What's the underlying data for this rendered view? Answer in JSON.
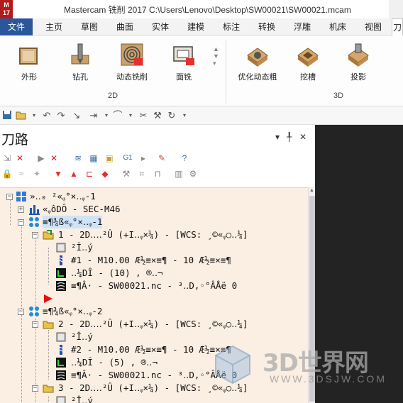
{
  "app": {
    "logo_text": "M\n17",
    "title": "Mastercam 铣削 2017  C:\\Users\\Lenovo\\Desktop\\SW00021\\SW00021.mcam"
  },
  "menu": {
    "tabs": [
      "文件",
      "主页",
      "草图",
      "曲面",
      "实体",
      "建模",
      "标注",
      "转换",
      "浮雕",
      "机床",
      "视图",
      "刀"
    ]
  },
  "ribbon": {
    "group_2d": {
      "label": "2D",
      "buttons": [
        "外形",
        "钻孔",
        "动态铣削",
        "面铣"
      ]
    },
    "group_3d": {
      "label": "3D",
      "buttons": [
        "优化动态粗",
        "挖槽",
        "投影"
      ]
    }
  },
  "panel": {
    "title": "刀路",
    "pin": "▾ ╀ ✕",
    "row1_glyph": "G1"
  },
  "tree": {
    "root": "»‥₀ ²«ᵩ°×‥ᵩ-1",
    "machine": "«ᵩôDÔ - SEC-M46",
    "group1": "≡¶¾ß«ᵩ°×‥ᵩ-1",
    "op1": {
      "title": "1 - 2D‥‥²Û (+I‥ᵩ×¼) - [WCS: ¸©«ᵩ○‥¼]",
      "params": "²Î‥ý",
      "tool": "#1 - M10.00 Æ½≡×≡¶ - 10 Æ½≡×≡¶",
      "geometry": "‥¼DÎ - (10) , ®‥¬",
      "toolpath": "≡¶Â· - SW00021.nc - ³‥D‚◦°ÂÅë 0"
    },
    "group2": "≡¶¾ß«ᵩ°×‥ᵩ-2",
    "op2": {
      "title": "2 - 2D‥‥²Û (+I‥ᵩ×¼) - [WCS: ¸©«ᵩ○‥¼]",
      "params": "²Î‥ý",
      "tool": "#2 - M10.00 Æ½≡×≡¶ - 10 Æ½≡×≡¶",
      "geometry": "‥¼DÎ - (5) , ®‥¬",
      "toolpath": "≡¶Â· - SW00021.nc - ³‥D‚◦°ÂÅë 0"
    },
    "op3": {
      "title": "3 - 2D‥‥²Û (+I‥ᵩ×¼) - [WCS: ¸©«ᵩ○‥¼]",
      "params": "²Î‥ý"
    }
  },
  "watermark": {
    "text": "3D世界网",
    "url": "WWW.3DSJW.COM"
  },
  "colors": {
    "file_tab": "#2b579a",
    "tree_bg": "#fbeee2",
    "selection": "#cfe3f7",
    "insert_arrow": "#e01010",
    "viewport": "#232323"
  }
}
